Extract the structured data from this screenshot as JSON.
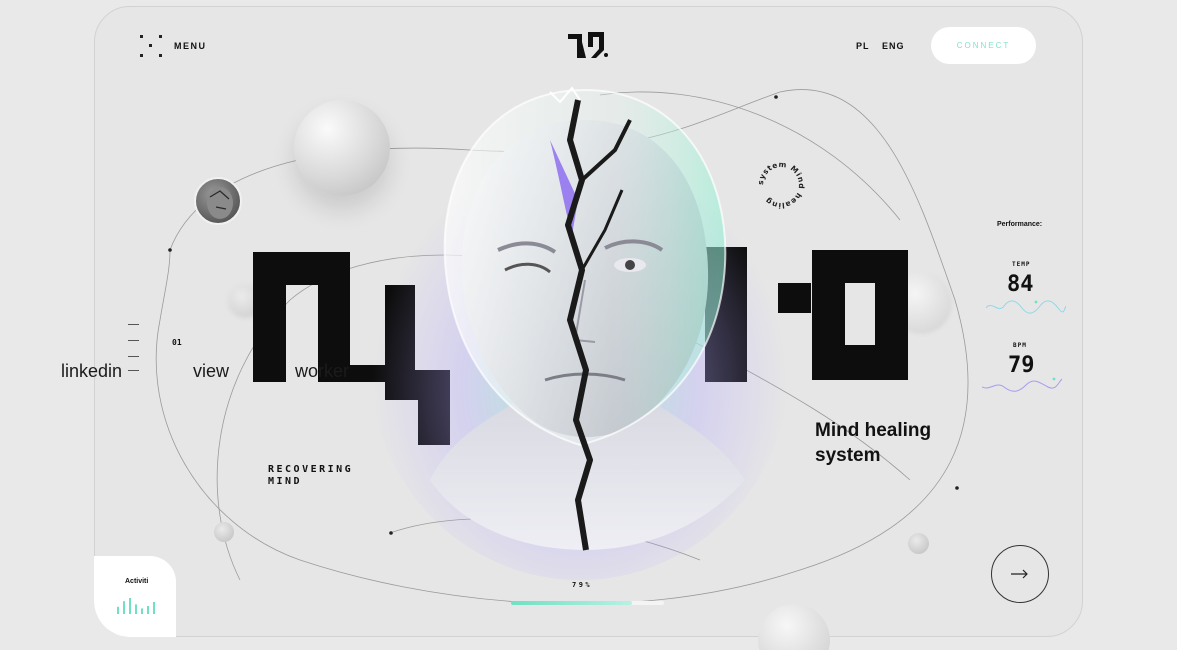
{
  "header": {
    "menu_label": "MENU",
    "lang_pl": "PL",
    "lang_eng": "ENG",
    "connect_label": "CONNECT"
  },
  "nav": {
    "number": "01",
    "links": [
      "linkedin",
      "view",
      "worker"
    ]
  },
  "hero": {
    "subtitle_lines": [
      "RECOVERING",
      "MIND"
    ],
    "tagline_lines": [
      "Mind healing",
      "system"
    ],
    "badge_text": "system Mind healing"
  },
  "performance": {
    "title": "Performance:",
    "temp_label": "TEMP",
    "temp_value": "84",
    "bpm_label": "BPM",
    "bpm_value": "79"
  },
  "activity": {
    "label": "Activiti",
    "bar_levels": [
      0.45,
      0.8,
      1.0,
      0.6,
      0.35,
      0.5,
      0.75
    ]
  },
  "progress": {
    "text": "79%",
    "value": 0.79
  },
  "colors": {
    "accent": "#6fe0c3",
    "accent_purple": "#9a7cf0",
    "text_dark": "#111111",
    "background": "#e6e6e6"
  },
  "icons": {
    "menu": "menu-dots-icon",
    "arrow": "arrow-right-icon"
  }
}
